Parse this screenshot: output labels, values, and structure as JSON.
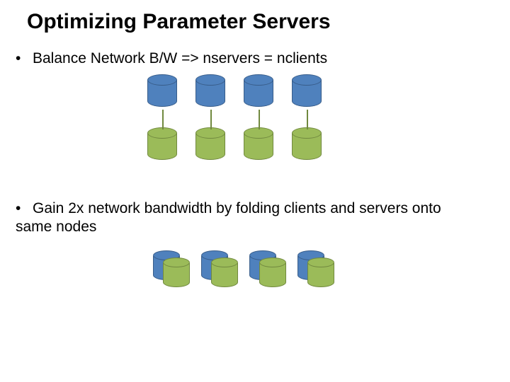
{
  "title": "Optimizing Parameter Servers",
  "bullets": {
    "b1": "Balance Network B/W => nservers = nclients",
    "b2": "Gain 2x network bandwidth by folding clients and servers onto same nodes"
  },
  "colors": {
    "server": "#4f81bd",
    "client": "#9bbb59"
  },
  "diagram": {
    "sectionA": {
      "servers": 4,
      "clients": 4
    },
    "sectionB": {
      "pairs": 4
    }
  }
}
